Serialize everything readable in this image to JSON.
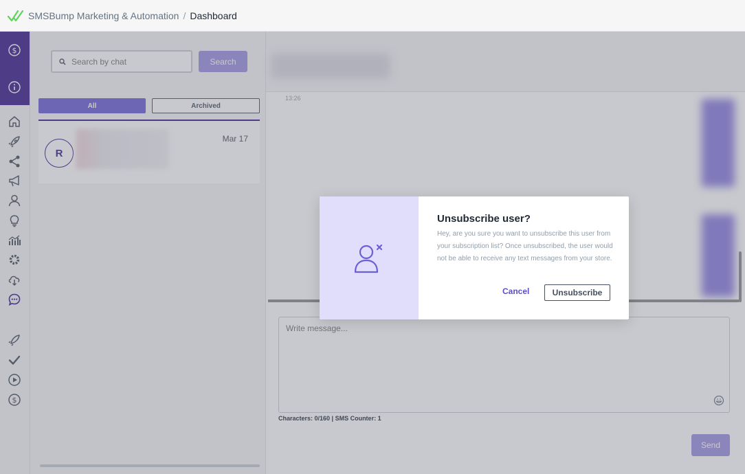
{
  "topbar": {
    "app_name": "SMSBump Marketing & Automation",
    "separator": "/",
    "breadcrumb": "Dashboard",
    "logo_color": "#5fd35b"
  },
  "rail": {
    "top_icons": [
      "dollar-icon",
      "info-icon"
    ],
    "icons": [
      "home-icon",
      "rocket-icon",
      "share-icon",
      "megaphone-icon",
      "user-icon",
      "lightbulb-icon",
      "bar-chart-icon",
      "gear-icon",
      "cloud-icon",
      "chat-icon",
      "rocket-outline-icon",
      "check-icon",
      "play-icon",
      "dollar-icon"
    ],
    "accent": "#3a1c8c"
  },
  "chat_list": {
    "search_placeholder": "Search by chat",
    "search_button": "Search",
    "tabs": [
      {
        "label": "All",
        "active": true
      },
      {
        "label": "Archived",
        "active": false
      }
    ],
    "items": [
      {
        "avatar_letter": "R",
        "date": "Mar 17"
      }
    ]
  },
  "conversation": {
    "timestamp": "13:26",
    "compose_placeholder": "Write message...",
    "counter": "Characters: 0/160 | SMS Counter: 1",
    "send_button": "Send"
  },
  "modal": {
    "title": "Unsubscribe user?",
    "body": "Hey, are you sure you want to unsubscribe this user from your subscription list? Once unsubscribed, the user would not be able to receive any text messages from your store.",
    "cancel_label": "Cancel",
    "confirm_label": "Unsubscribe",
    "art_color": "#e0defa",
    "icon_color": "#6b5fd6"
  }
}
